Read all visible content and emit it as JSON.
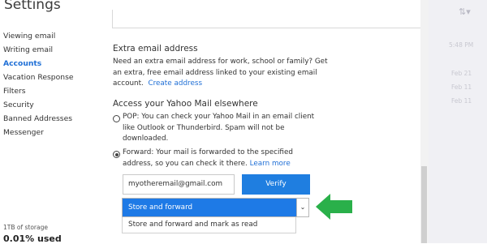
{
  "header": {
    "title": "Settings"
  },
  "sidebar": {
    "items": [
      {
        "label": "Viewing email"
      },
      {
        "label": "Writing email"
      },
      {
        "label": "Accounts"
      },
      {
        "label": "Vacation Response"
      },
      {
        "label": "Filters"
      },
      {
        "label": "Security"
      },
      {
        "label": "Banned Addresses"
      },
      {
        "label": "Messenger"
      }
    ],
    "active_item": "Accounts",
    "storage_label": "1TB of storage",
    "storage_used": "0.01% used"
  },
  "extra_email": {
    "heading": "Extra email address",
    "description_line1": "Need an extra email address for work, school or family? Get",
    "description_line2": "an extra, free email address linked to your existing email",
    "description_line3_prefix": "account.",
    "create_link": "Create address"
  },
  "access_elsewhere": {
    "heading": "Access your Yahoo Mail elsewhere",
    "pop": {
      "line1": "POP: You can check your Yahoo Mail in an email client",
      "line2": "like Outlook or Thunderbird. Spam will not be",
      "line3": "downloaded.",
      "checked": false
    },
    "forward": {
      "line1": "Forward: Your mail is forwarded to the specified",
      "line2_prefix": "address, so you can check it there.",
      "learn_more": "Learn more",
      "checked": true
    },
    "email_value": "myotheremail@gmail.com",
    "verify_label": "Verify",
    "select": {
      "selected": "Store and forward",
      "options": [
        "Store and forward",
        "Store and forward and mark as read"
      ],
      "visible_option": "Store and forward and mark as read"
    }
  },
  "right_panel": {
    "time": "5:48 PM",
    "dates": [
      "Feb 21",
      "Feb 11",
      "Feb 11"
    ]
  },
  "colors": {
    "accent": "#1f7ee0",
    "link": "#1f6fd6",
    "annotation_arrow": "#2ab04a"
  }
}
